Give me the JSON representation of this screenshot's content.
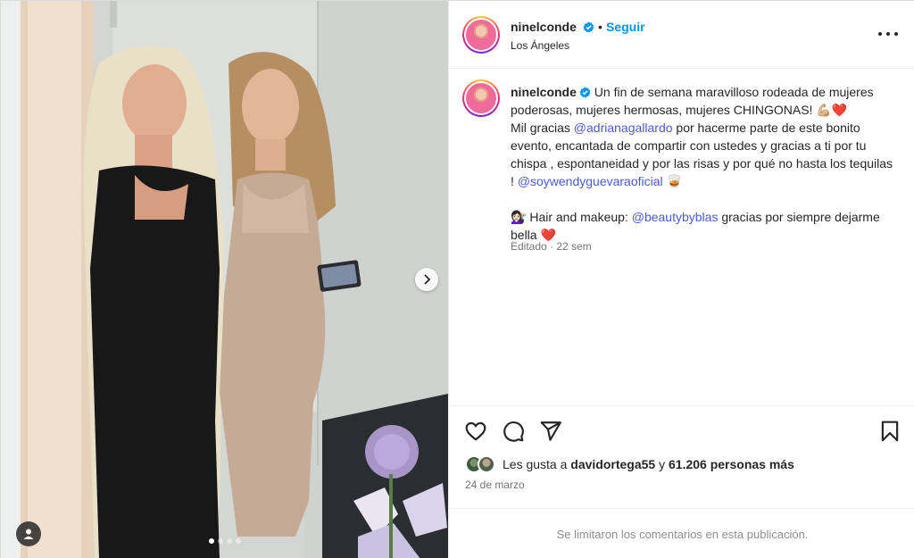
{
  "post": {
    "username": "ninelconde",
    "separator": "•",
    "follow_label": "Seguir",
    "location": "Los Ángeles"
  },
  "caption": {
    "username": "ninelconde",
    "line1_text": "Un fin de semana maravilloso rodeada de mujeres poderosas, mujeres hermosas, mujeres CHINGONAS!",
    "line1_emoji": "💪🏼❤️",
    "thanks_prefix": "Mil gracias",
    "mention1": "@adrianagallardo",
    "thanks_middle": "por hacerme parte de este bonito evento, encantada de compartir con ustedes y gracias a ti por tu chispa , espontaneidad y por las risas y por qué no hasta los tequilas !",
    "mention2": "@soywendyguevaraoficial",
    "mention2_emoji": "🥃",
    "credit_emoji": "💇🏻‍♀️",
    "credit_prefix": "Hair and makeup:",
    "mention3": "@beautybyblas",
    "credit_suffix": "gracias por siempre dejarme bella",
    "credit_suffix_emoji": "❤️",
    "edited": "Editado · 22 sem"
  },
  "likes": {
    "prefix": "Les gusta a",
    "user": "davidortega55",
    "conjunction": "y",
    "count": "61.206 personas más"
  },
  "date": "24 de marzo",
  "comments_limited": "Se limitaron los comentarios en esta publicación.",
  "carousel": {
    "total_slides": 4,
    "active_index": 0
  },
  "icons": {
    "verified": "verified-badge-icon",
    "more": "more-options-icon",
    "like": "heart-icon",
    "comment": "comment-icon",
    "share": "share-icon",
    "save": "bookmark-icon",
    "next": "chevron-right-icon",
    "tags": "user-tag-icon"
  },
  "colors": {
    "accent": "#0095f6",
    "verified": "#0095f6",
    "mention": "#00376b",
    "muted": "#737373"
  }
}
